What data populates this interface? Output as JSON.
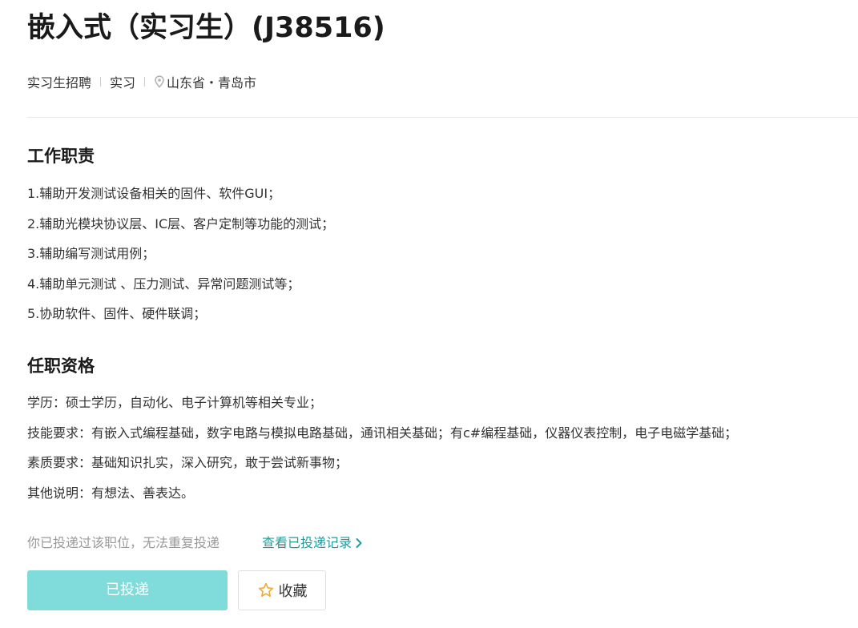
{
  "job": {
    "title": "嵌入式（实习生）(J38516)",
    "category": "实习生招聘",
    "type": "实习",
    "location": "山东省・青岛市"
  },
  "duties": {
    "heading": "工作职责",
    "items": [
      "1.辅助开发测试设备相关的固件、软件GUI；",
      "2.辅助光模块协议层、IC层、客户定制等功能的测试；",
      "3.辅助编写测试用例；",
      "4.辅助单元测试 、压力测试、异常问题测试等；",
      "5.协助软件、固件、硬件联调；"
    ]
  },
  "requirements": {
    "heading": "任职资格",
    "items": [
      "学历：硕士学历，自动化、电子计算机等相关专业；",
      "技能要求：有嵌入式编程基础，数字电路与模拟电路基础，通讯相关基础；有c#编程基础，仪器仪表控制，电子电磁学基础；",
      "素质要求：基础知识扎实，深入研究，敢于尝试新事物；",
      "其他说明：有想法、善表达。"
    ]
  },
  "application": {
    "notice": "你已投递过该职位，无法重复投递",
    "record_link": "查看已投递记录",
    "applied_button": "已投递",
    "favorite_button": "收藏"
  },
  "icons": {
    "location": "map-pin-icon",
    "chevron": "chevron-right-icon",
    "favorite": "star-outline-icon"
  },
  "colors": {
    "accent": "#1f9c9c",
    "applied_button_bg": "#7fdcda",
    "star": "#f2a93b",
    "muted_text": "#999999"
  }
}
